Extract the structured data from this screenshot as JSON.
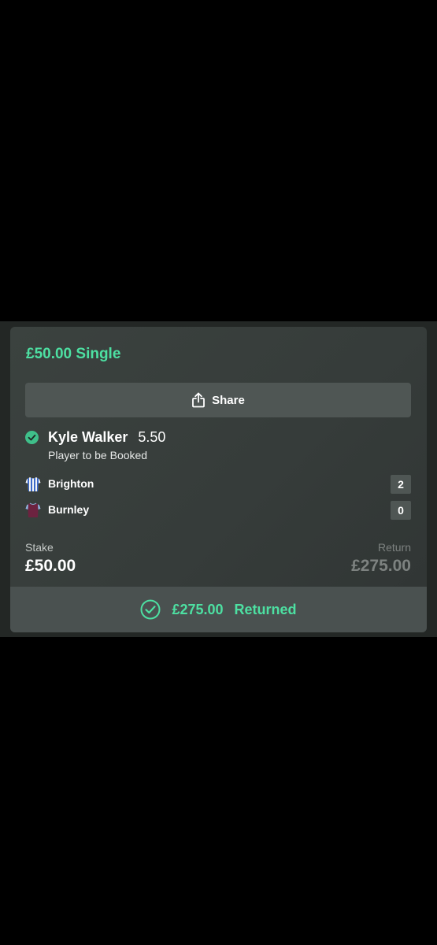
{
  "bet": {
    "title": "£50.00 Single",
    "share_label": "Share",
    "selection": {
      "name": "Kyle Walker",
      "odds": "5.50",
      "market": "Player to be Booked",
      "status": "won"
    },
    "teams": [
      {
        "name": "Brighton",
        "score": "2",
        "shirt": "striped-blue-white-shirt-icon"
      },
      {
        "name": "Burnley",
        "score": "0",
        "shirt": "claret-shirt-icon"
      }
    ],
    "stake_label": "Stake",
    "stake_value": "£50.00",
    "return_label": "Return",
    "return_value": "£275.00",
    "result": {
      "amount": "£275.00",
      "text": "Returned"
    }
  },
  "colors": {
    "accent_green": "#4de0a2",
    "card_bg": "#3b423f",
    "button_bg": "#4f5654",
    "muted_text": "#7d8280"
  }
}
